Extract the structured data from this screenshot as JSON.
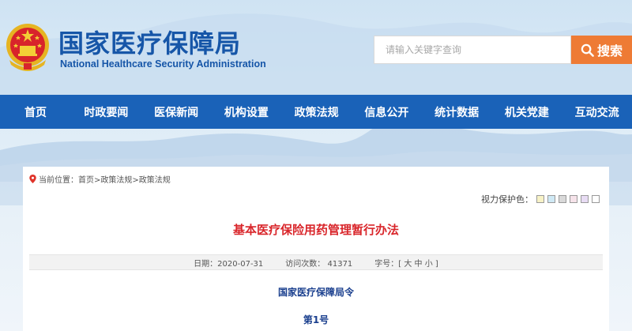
{
  "header": {
    "title_cn": "国家医疗保障局",
    "title_en": "National Healthcare Security Administration",
    "emblem_icon": "national-emblem-icon"
  },
  "search": {
    "placeholder": "请输入关键字查询",
    "button_label": "搜索",
    "icon": "search-icon"
  },
  "nav": {
    "items": [
      "首页",
      "时政要闻",
      "医保新闻",
      "机构设置",
      "政策法规",
      "信息公开",
      "统计数据",
      "机关党建",
      "互动交流"
    ]
  },
  "breadcrumb": {
    "icon": "location-pin-icon",
    "text": "当前位置：首页>政策法规>政策法规"
  },
  "vision": {
    "label": "视力保护色：",
    "colors": [
      "#f7f2c6",
      "#cfe9f5",
      "#d9d9d9",
      "#f6e3ea",
      "#e8dcf4",
      "#ffffff"
    ]
  },
  "article": {
    "title": "基本医疗保险用药管理暂行办法",
    "date": "日期：2020-07-31",
    "views_label": "访问次数：",
    "views": "41371",
    "font_size": "字号：[ 大 中 小 ]",
    "subtitle": "国家医疗保障局令",
    "order": "第1号"
  },
  "colors": {
    "brand_blue": "#1a62b8",
    "title_blue": "#1656a8",
    "accent_orange": "#ee7b35",
    "title_red": "#d9262b"
  }
}
